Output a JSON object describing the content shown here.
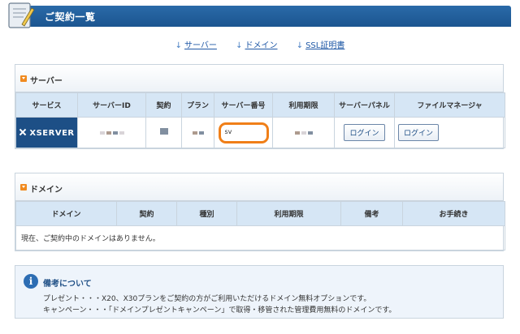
{
  "header": {
    "title": "ご契約一覧"
  },
  "anchors": [
    {
      "arrow": "↓",
      "label": "サーバー"
    },
    {
      "arrow": "↓",
      "label": "ドメイン"
    },
    {
      "arrow": "↓",
      "label": "SSL証明書"
    }
  ],
  "server_panel": {
    "title": "サーバー",
    "columns": [
      "サービス",
      "サーバーID",
      "契約",
      "プラン",
      "サーバー番号",
      "利用期限",
      "サーバーパネル",
      "ファイルマネージャ"
    ],
    "row": {
      "service": "XSERVER",
      "server_number": "sv",
      "panel_login": "ログイン",
      "file_login": "ログイン"
    }
  },
  "domain_panel": {
    "title": "ドメイン",
    "columns": [
      "ドメイン",
      "契約",
      "種別",
      "利用期限",
      "備考",
      "お手続き"
    ],
    "empty_message": "現在、ご契約中のドメインはありません。"
  },
  "note": {
    "title": "備考について",
    "lines": [
      "プレゼント・・・X20、X30プランをご契約の方がご利用いただけるドメイン無料オプションです。",
      "キャンペーン・・・「ドメインプレゼントキャンペーン」で取得・移管された管理費用無料のドメインです。"
    ]
  },
  "colors": {
    "header": "#1b5590",
    "highlight": "#f07f18",
    "table_head": "#d6e6f5",
    "accent": "#f08a1f"
  }
}
